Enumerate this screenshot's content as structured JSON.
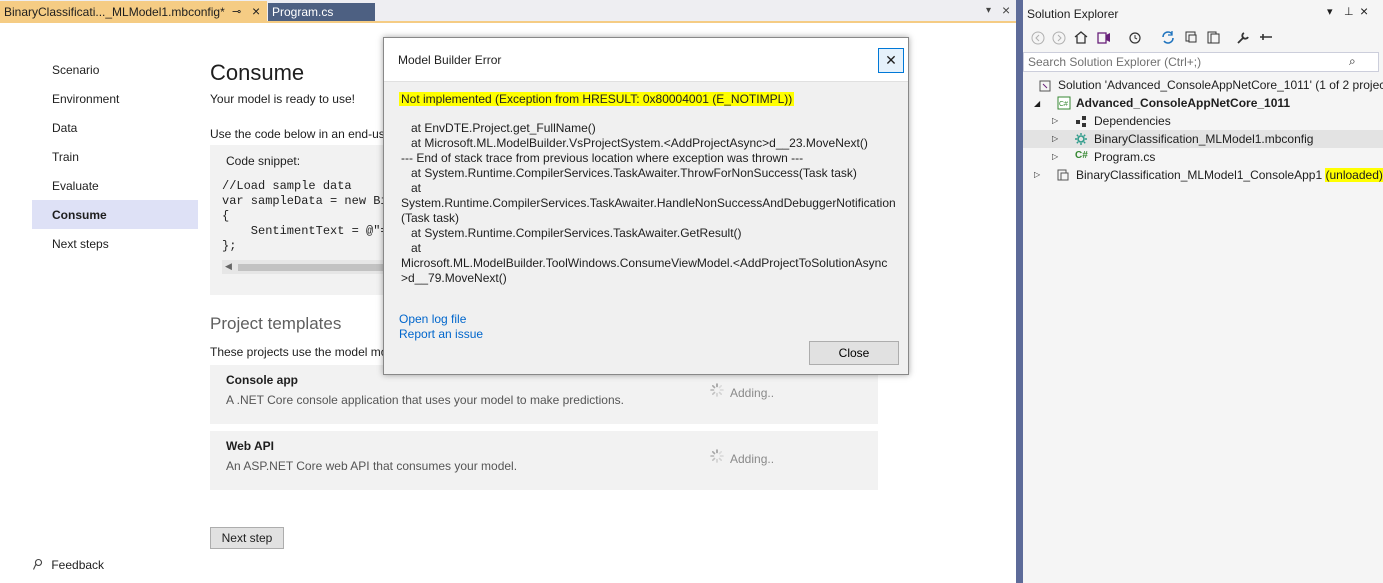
{
  "tabs": {
    "active_label": "BinaryClassificati..._MLModel1.mbconfig*",
    "pin_glyph": "⊸",
    "close_glyph": "×",
    "inactive_label": "Program.cs",
    "menu_glyph": "▾",
    "strip_close_glyph": "×"
  },
  "nav": {
    "items": [
      "Scenario",
      "Environment",
      "Data",
      "Train",
      "Evaluate",
      "Consume",
      "Next steps"
    ],
    "active": "Consume"
  },
  "main": {
    "title": "Consume",
    "subtitle": "Your model is ready to use!",
    "description": "Use the code below in an end-us",
    "snippet_label": "Code snippet:",
    "code_lines": [
      "//Load sample data",
      "var sampleData = new Bi",
      "{",
      "    SentimentText = @\"=",
      "};"
    ],
    "scroll_left_glyph": "◀",
    "templates_title": "Project templates",
    "templates_desc": "These projects use the model mo",
    "cards": [
      {
        "title": "Console app",
        "desc": "A .NET Core console application that uses your model to make predictions.",
        "status": "Adding.."
      },
      {
        "title": "Web API",
        "desc": "An ASP.NET Core web API that consumes your model.",
        "status": "Adding.."
      }
    ],
    "next_button": "Next step",
    "feedback": "Feedback"
  },
  "dialog": {
    "title": "Model Builder Error",
    "close_glyph": "✕",
    "error_message": "Not implemented (Exception from HRESULT: 0x80004001 (E_NOTIMPL))",
    "stack_trace": "   at EnvDTE.Project.get_FullName()\n   at Microsoft.ML.ModelBuilder.VsProjectSystem.<AddProjectAsync>d__23.MoveNext()\n--- End of stack trace from previous location where exception was thrown ---\n   at System.Runtime.CompilerServices.TaskAwaiter.ThrowForNonSuccess(Task task)\n   at\nSystem.Runtime.CompilerServices.TaskAwaiter.HandleNonSuccessAndDebuggerNotification\n(Task task)\n   at System.Runtime.CompilerServices.TaskAwaiter.GetResult()\n   at\nMicrosoft.ML.ModelBuilder.ToolWindows.ConsumeViewModel.<AddProjectToSolutionAsync\n>d__79.MoveNext()",
    "link_log": "Open log file",
    "link_issue": "Report an issue",
    "close_button": "Close"
  },
  "solution_explorer": {
    "title": "Solution Explorer",
    "header_controls": {
      "dropdown": "▾",
      "pin": "⊥",
      "close": "×"
    },
    "search_placeholder": "Search Solution Explorer (Ctrl+;)",
    "search_icon_glyph": "⌕",
    "toolbar_icons": [
      "back-icon",
      "forward-icon",
      "home-icon",
      "vs-switch-icon",
      "history-icon",
      "sync-icon",
      "collapse-all-icon",
      "show-all-files-icon",
      "properties-icon",
      "preview-icon"
    ],
    "tree": {
      "solution": "Solution 'Advanced_ConsoleAppNetCore_1011' (1 of 2 projec",
      "project": "Advanced_ConsoleAppNetCore_1011",
      "dependencies": "Dependencies",
      "mbconfig": "BinaryClassification_MLModel1.mbconfig",
      "program": "Program.cs",
      "unloaded_project": "BinaryClassification_MLModel1_ConsoleApp1",
      "unloaded_tag": "(unloaded)"
    },
    "highlight_color": "#ffff00"
  }
}
